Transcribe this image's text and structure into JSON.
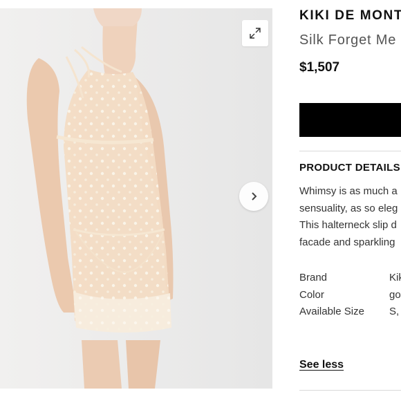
{
  "gallery": {
    "image_alt": "Model wearing sheer embellished halterneck slip dress",
    "expand_icon": "expand-arrows-icon",
    "next_icon": "chevron-right-icon"
  },
  "product": {
    "brand": "KIKI DE MONTPARNASSE",
    "name": "Silk Forget Me Not Slip Dress",
    "price": "$1,507"
  },
  "details": {
    "heading": "PRODUCT DETAILS",
    "description_lines": [
      "Whimsy is as much a",
      "sensuality, as so eleg",
      "This halterneck slip d",
      "facade and sparkling"
    ],
    "specs": [
      {
        "label": "Brand",
        "value": "Kiki de Montparnasse"
      },
      {
        "label": "Color",
        "value": "gold"
      },
      {
        "label": "Available Size",
        "value": "S, M, L"
      }
    ],
    "see_less": "See less"
  },
  "colors": {
    "button": "#000000",
    "gallery_bg": "#ececec",
    "text": "#111111"
  }
}
